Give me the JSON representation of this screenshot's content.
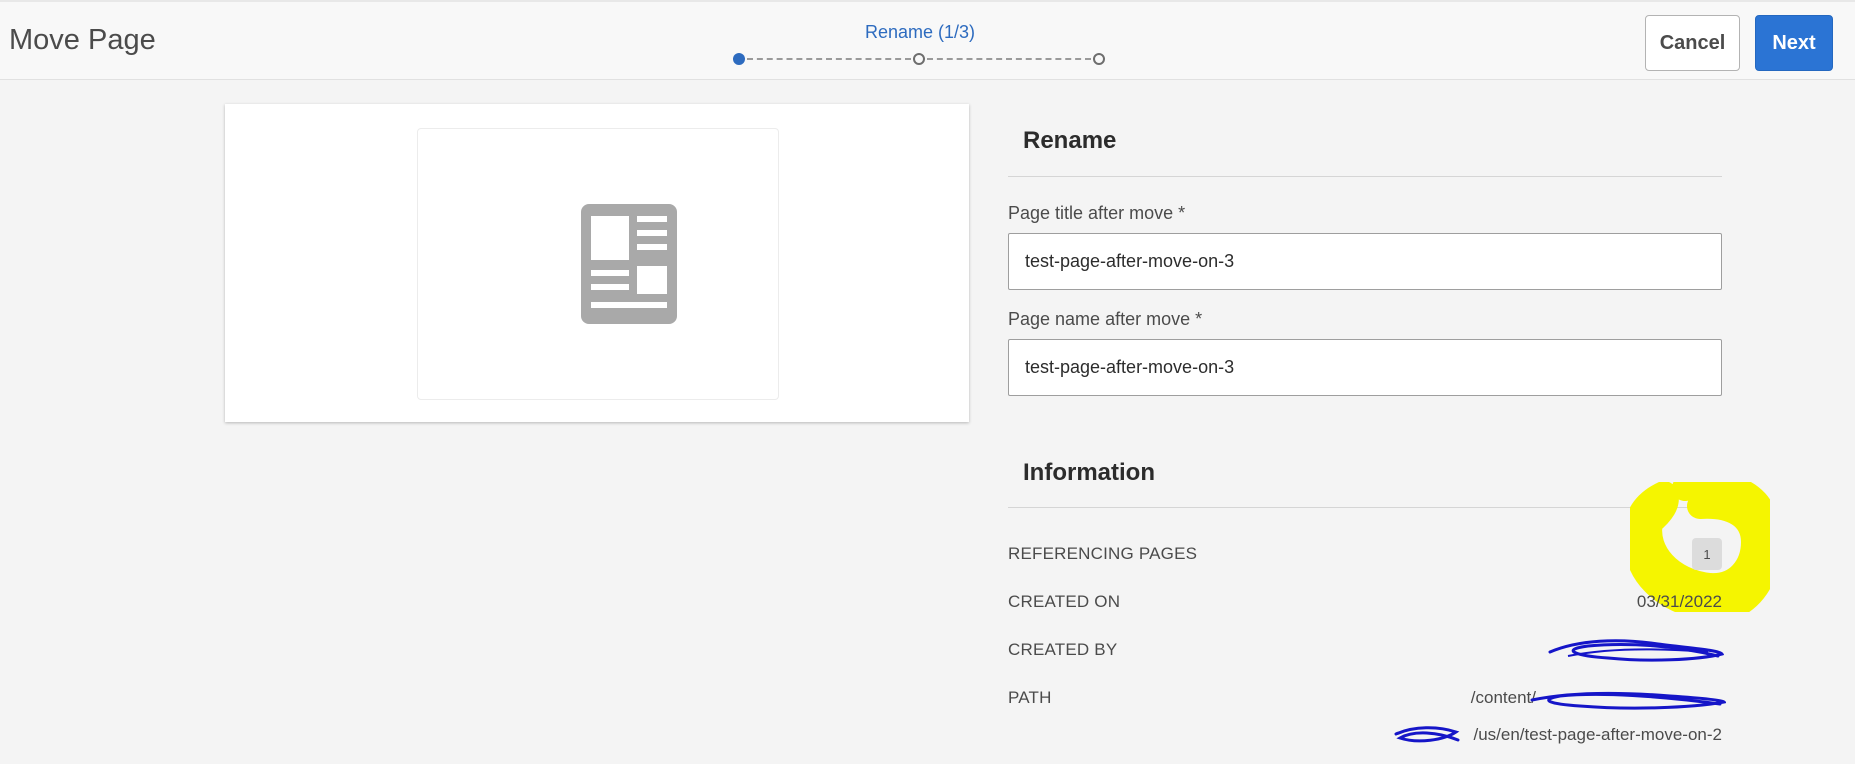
{
  "header": {
    "title": "Move Page",
    "wizard_step_label": "Rename (1/3)",
    "cancel_label": "Cancel",
    "next_label": "Next",
    "step_count": 3,
    "active_step": 1
  },
  "rename": {
    "heading": "Rename",
    "title_label": "Page title after move *",
    "title_value": "test-page-after-move-on-3",
    "name_label": "Page name after move *",
    "name_value": "test-page-after-move-on-3"
  },
  "information": {
    "heading": "Information",
    "referencing_pages_label": "REFERENCING PAGES",
    "referencing_pages_value": "1",
    "created_on_label": "CREATED ON",
    "created_on_value": "03/31/2022",
    "created_by_label": "CREATED BY",
    "path_label": "PATH",
    "path_line1": "/content/",
    "path_line2": "/us/en/test-page-after-move-on-2"
  },
  "colors": {
    "accent": "#2b74d4",
    "highlight": "#f5f500",
    "scribble": "#1515c8"
  },
  "icons": {
    "page_thumbnail": "page-template-icon"
  }
}
